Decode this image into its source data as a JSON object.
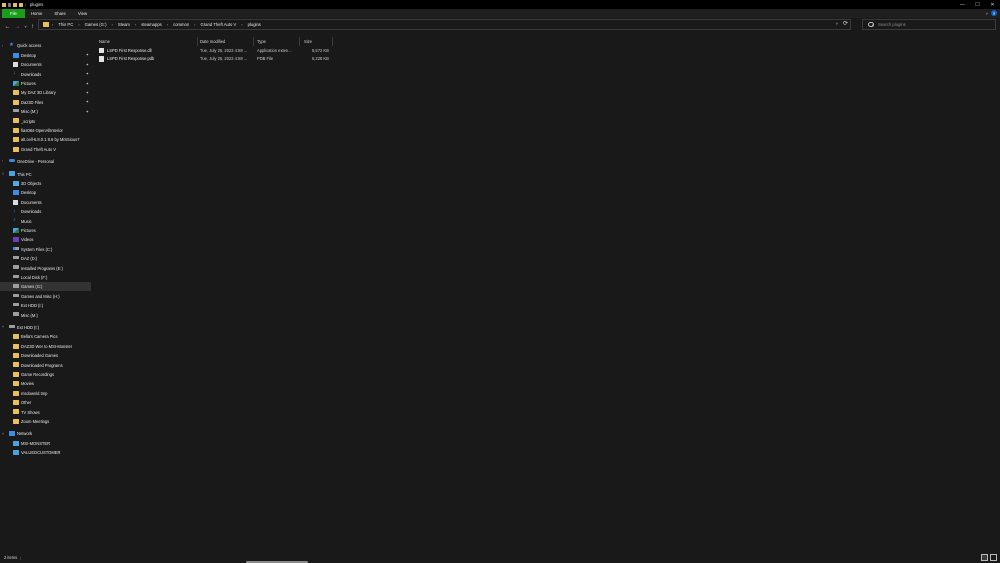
{
  "window": {
    "title": "plugins",
    "controls": {
      "minimize": "—",
      "maximize": "☐",
      "close": "✕"
    }
  },
  "ribbon": {
    "tabs": [
      "File",
      "Home",
      "Share",
      "View"
    ],
    "help_label": "?",
    "expand_icon": "chevron-down-icon"
  },
  "nav": {
    "back": "←",
    "forward": "→",
    "recent": "˅",
    "up": "↑"
  },
  "address": {
    "crumbs": [
      "This PC",
      "Games (G:)",
      "Steam",
      "steamapps",
      "common",
      "Grand Theft Auto V",
      "plugins"
    ],
    "separator": "›",
    "dropdown": "˅",
    "refresh": "⟳"
  },
  "search": {
    "placeholder": "Search plugins"
  },
  "sidebar": {
    "items": [
      {
        "label": "Quick access",
        "icon": "star-icon",
        "level": 0,
        "expand": "›"
      },
      {
        "label": "Desktop",
        "icon": "desktop-icon",
        "level": 1,
        "pinned": true
      },
      {
        "label": "Documents",
        "icon": "documents-icon",
        "level": 1,
        "pinned": true
      },
      {
        "label": "Downloads",
        "icon": "downloads-icon",
        "level": 1,
        "pinned": true
      },
      {
        "label": "Pictures",
        "icon": "pictures-icon",
        "level": 1,
        "pinned": true
      },
      {
        "label": "My DAZ 3D Library",
        "icon": "folder-icon",
        "level": 1,
        "pinned": true
      },
      {
        "label": "Daz3D Files",
        "icon": "folder-icon",
        "level": 1,
        "pinned": true
      },
      {
        "label": "Misc (M:)",
        "icon": "drive-icon",
        "level": 1,
        "pinned": true
      },
      {
        "label": "_scripts",
        "icon": "folder-icon",
        "level": 1
      },
      {
        "label": "fias084-OpenAllInterior",
        "icon": "folder-icon",
        "level": 1
      },
      {
        "label": "alt.cell-6.8.0.1 8.6 by MiSSious7",
        "icon": "folder-icon",
        "level": 1
      },
      {
        "label": "Grand Theft Auto V",
        "icon": "folder-icon",
        "level": 1
      },
      {
        "label": "OneDrive - Personal",
        "icon": "onedrive-icon",
        "level": 0,
        "expand": "›"
      },
      {
        "label": "This PC",
        "icon": "this-pc-icon",
        "level": 0,
        "expand": "˅"
      },
      {
        "label": "3D Objects",
        "icon": "3d-objects-icon",
        "level": 1,
        "expand": "›"
      },
      {
        "label": "Desktop",
        "icon": "desktop-icon",
        "level": 1,
        "expand": "›"
      },
      {
        "label": "Documents",
        "icon": "documents-icon",
        "level": 1,
        "expand": "›"
      },
      {
        "label": "Downloads",
        "icon": "downloads-icon",
        "level": 1,
        "expand": "›"
      },
      {
        "label": "Music",
        "icon": "music-icon",
        "level": 1,
        "expand": "›"
      },
      {
        "label": "Pictures",
        "icon": "pictures-icon",
        "level": 1,
        "expand": "›"
      },
      {
        "label": "Videos",
        "icon": "videos-icon",
        "level": 1,
        "expand": "›"
      },
      {
        "label": "System Files (C:)",
        "icon": "windows-drive-icon",
        "level": 1,
        "expand": "›"
      },
      {
        "label": "DAZ (D:)",
        "icon": "drive-icon",
        "level": 1,
        "expand": "›"
      },
      {
        "label": "Installed Programs (E:)",
        "icon": "drive-icon",
        "level": 1,
        "expand": "›"
      },
      {
        "label": "Local Disk (F:)",
        "icon": "drive-icon",
        "level": 1,
        "expand": "›"
      },
      {
        "label": "Games (G:)",
        "icon": "drive-icon",
        "level": 1,
        "expand": "›",
        "selected": true
      },
      {
        "label": "Games and Misc (H:)",
        "icon": "drive-icon",
        "level": 1,
        "expand": "›"
      },
      {
        "label": "Ext HDD (I:)",
        "icon": "drive-icon",
        "level": 1,
        "expand": "›"
      },
      {
        "label": "Misc (M:)",
        "icon": "drive-icon",
        "level": 1,
        "expand": "›"
      },
      {
        "label": "Ext HDD (I:)",
        "icon": "drive-icon",
        "level": 0,
        "expand": "˅"
      },
      {
        "label": "Bella's Camera Pics",
        "icon": "folder-icon",
        "level": 1,
        "expand": "›"
      },
      {
        "label": "DAZ3D Wer to MSI-Monster",
        "icon": "folder-icon",
        "level": 1,
        "expand": "›"
      },
      {
        "label": "Downloaded Games",
        "icon": "folder-icon",
        "level": 1,
        "expand": "›"
      },
      {
        "label": "Downloaded Programs",
        "icon": "folder-icon",
        "level": 1,
        "expand": "›"
      },
      {
        "label": "Game Recordings",
        "icon": "folder-icon",
        "level": 1,
        "expand": "›"
      },
      {
        "label": "Movies",
        "icon": "folder-icon",
        "level": 1,
        "expand": "›"
      },
      {
        "label": "msdownld.tmp",
        "icon": "folder-icon",
        "level": 1,
        "expand": "›"
      },
      {
        "label": "Other",
        "icon": "folder-icon",
        "level": 1,
        "expand": "›"
      },
      {
        "label": "TV Shows",
        "icon": "folder-icon",
        "level": 1,
        "expand": "›"
      },
      {
        "label": "Zoom Meetings",
        "icon": "folder-icon",
        "level": 1,
        "expand": "›"
      },
      {
        "label": "Network",
        "icon": "network-icon",
        "level": 0,
        "expand": "˅"
      },
      {
        "label": "MSI-MONSTER",
        "icon": "network-computer-icon",
        "level": 1,
        "expand": "›"
      },
      {
        "label": "VALUEDCUSTOMER",
        "icon": "network-computer-icon",
        "level": 1,
        "expand": "›"
      }
    ]
  },
  "columns": [
    "Name",
    "Date modified",
    "Type",
    "Size"
  ],
  "files": [
    {
      "name": "LSPD First Response.dll",
      "date": "Tue, July 26, 2022 4:59 ...",
      "type": "Application exten...",
      "size": "5,572 KB",
      "icon": "dll-file-icon"
    },
    {
      "name": "LSPD First Response.pdb",
      "date": "Tue, July 26, 2022 4:59 ...",
      "type": "PDB File",
      "size": "5,228 KB",
      "icon": "pdb-file-icon"
    }
  ],
  "status": {
    "count": "2 items",
    "separator": "|"
  },
  "colors": {
    "accent_file_tab": "#1a9e1a",
    "folder": "#e8bf5a",
    "help": "#0a64c8",
    "background": "#191919"
  }
}
